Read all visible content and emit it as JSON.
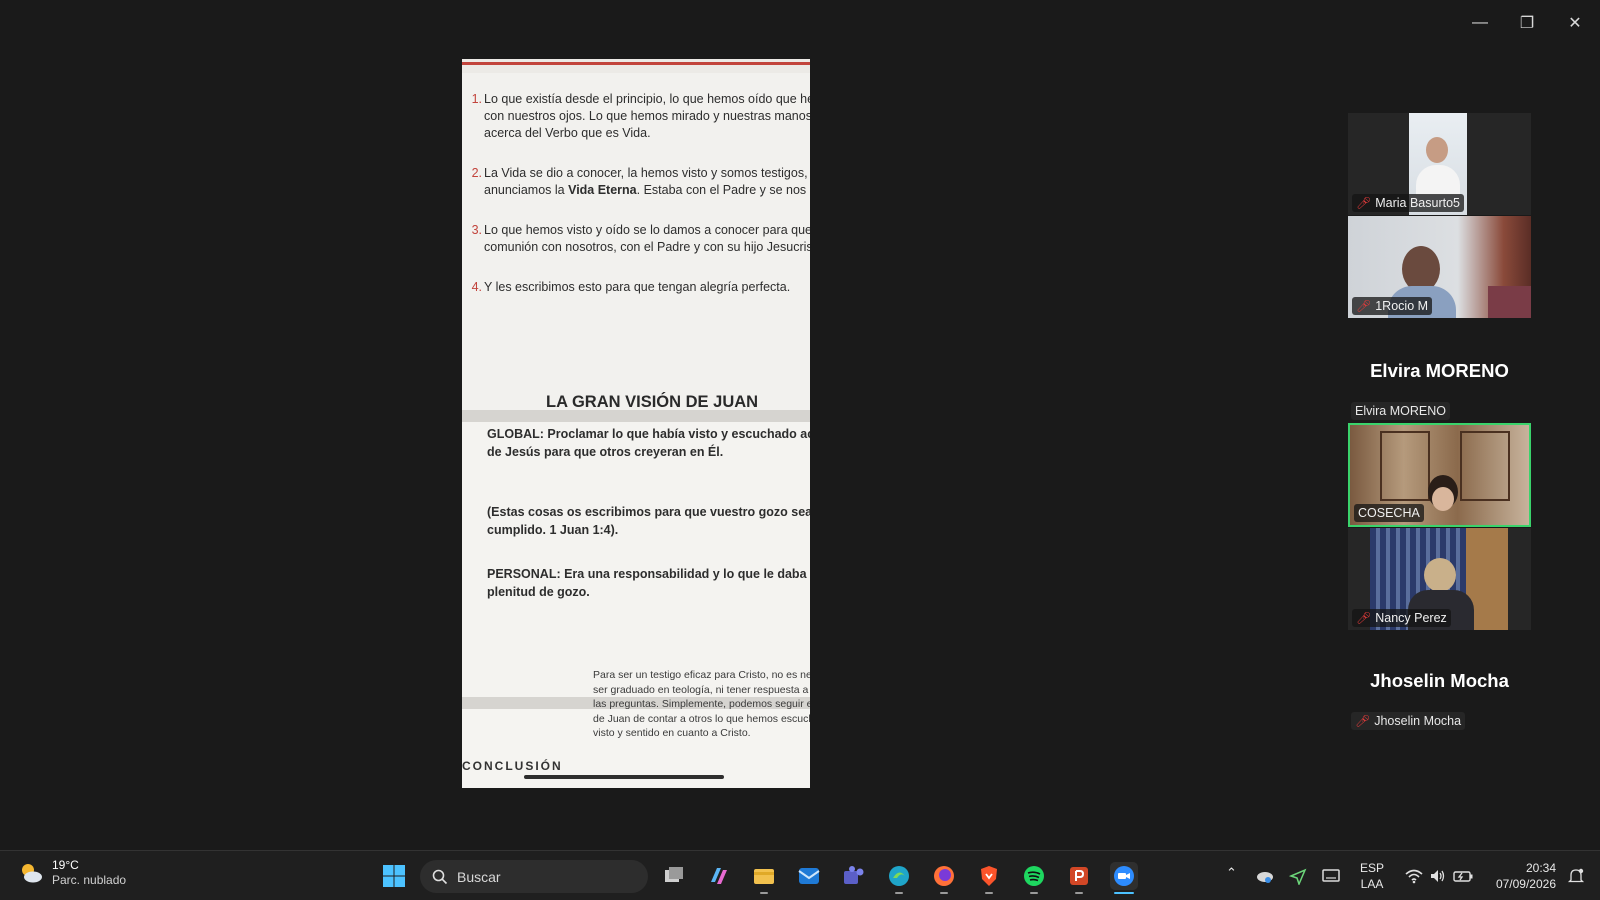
{
  "window": {
    "minimize_glyph": "—",
    "restore_glyph": "❐",
    "close_glyph": "✕"
  },
  "document": {
    "verses": [
      {
        "num": "1.",
        "text": "Lo que existía desde el principio, lo que hemos oído que hemos visto con nuestros ojos. Lo que hemos mirado y nuestras manos han palpado acerca del Verbo que es Vida."
      },
      {
        "num": "2.",
        "text_before": "La Vida se dio a conocer, la hemos visto y somos testigos, y les anunciamos la ",
        "text_bold": "Vida Eterna",
        "text_after": ". Estaba con el Padre y se nos apareció."
      },
      {
        "num": "3.",
        "text": "Lo que hemos visto y oído se lo damos a conocer para que estén en comunión con nosotros, con el Padre y con su hijo Jesucristo."
      },
      {
        "num": "4.",
        "text": "Y les escribimos esto para que tengan alegría perfecta."
      }
    ],
    "section_title": "LA GRAN VISIÓN DE JUAN",
    "global_label": "GLOBAL:",
    "global_text": " Proclamar lo que había visto y escuchado acerca de Jesús para que otros creyeran en Él.",
    "quote": "(Estas cosas os escribimos para que vuestro gozo sea cumplido. 1 Juan 1:4).",
    "personal_label": "PERSONAL:",
    "personal_text": " Era una responsabilidad y lo que le daba plenitud de gozo.",
    "footnote": "Para ser un testigo eficaz para Cristo, no es necesario ser graduado en teología, ni tener respuesta a todas las preguntas. Simplemente, podemos seguir el modelo de Juan de contar a otros lo que hemos escuchado, visto y sentido en cuanto a Cristo.",
    "cut_heading": "CONCLUSIÓN"
  },
  "participants": {
    "tiles": [
      {
        "name": "Maria Basurto5",
        "muted": true
      },
      {
        "name": "1Rocio M",
        "muted": true
      }
    ],
    "elvira_big": "Elvira  MORENO",
    "elvira_small": "Elvira  MORENO",
    "active_tile": {
      "name": "COSECHA",
      "muted": false
    },
    "nancy_tile": {
      "name": "Nancy Perez",
      "muted": true
    },
    "jhoselin_big": "Jhoselin Mocha",
    "jhoselin_small": "Jhoselin Mocha",
    "active_color": "#3ad36b"
  },
  "taskbar": {
    "weather_temp": "19°C",
    "weather_cond": "Parc. nublado",
    "search_label": "Buscar",
    "apps": [
      "task-view",
      "copilot",
      "file-explorer",
      "outlook",
      "teams",
      "edge",
      "firefox",
      "brave",
      "spotify",
      "powerpoint",
      "zoom"
    ],
    "lang_top": "ESP",
    "lang_bottom": "LAA",
    "time": "20:34",
    "date": "07/09/2026"
  }
}
